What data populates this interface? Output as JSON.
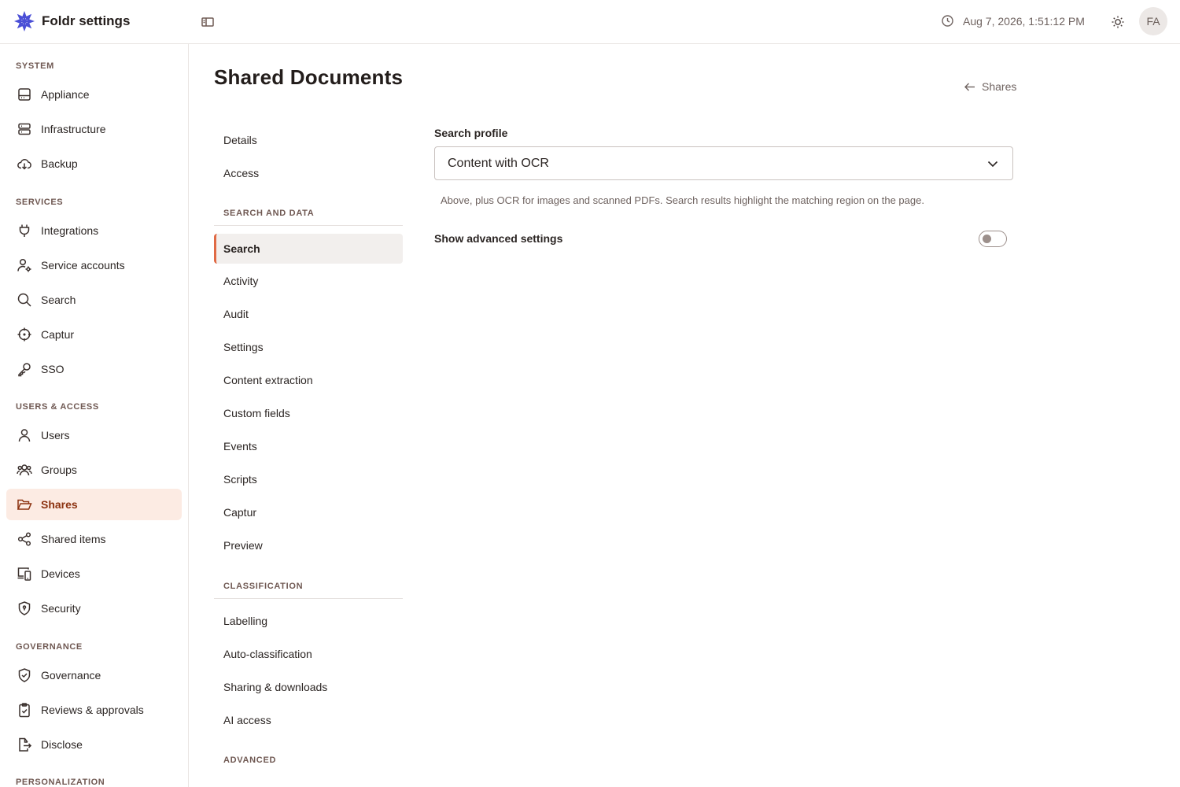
{
  "header": {
    "app_title": "Foldr settings",
    "datetime": "Aug 7, 2026, 1:51:12 PM",
    "avatar_initials": "FA",
    "brand_color": "#4a4fd6"
  },
  "sidebar": {
    "sections": [
      {
        "title": "SYSTEM",
        "items": [
          {
            "label": "Appliance",
            "icon": "appliance-icon"
          },
          {
            "label": "Infrastructure",
            "icon": "server-icon"
          },
          {
            "label": "Backup",
            "icon": "cloud-download-icon"
          }
        ]
      },
      {
        "title": "SERVICES",
        "items": [
          {
            "label": "Integrations",
            "icon": "plug-icon"
          },
          {
            "label": "Service accounts",
            "icon": "user-gear-icon"
          },
          {
            "label": "Search",
            "icon": "search-icon"
          },
          {
            "label": "Captur",
            "icon": "crosshair-icon"
          },
          {
            "label": "SSO",
            "icon": "key-icon"
          }
        ]
      },
      {
        "title": "USERS & ACCESS",
        "items": [
          {
            "label": "Users",
            "icon": "user-icon"
          },
          {
            "label": "Groups",
            "icon": "users-icon"
          },
          {
            "label": "Shares",
            "icon": "folder-open-icon",
            "active": true
          },
          {
            "label": "Shared items",
            "icon": "share-icon"
          },
          {
            "label": "Devices",
            "icon": "devices-icon"
          },
          {
            "label": "Security",
            "icon": "shield-icon"
          }
        ]
      },
      {
        "title": "GOVERNANCE",
        "items": [
          {
            "label": "Governance",
            "icon": "shield-check-icon"
          },
          {
            "label": "Reviews & approvals",
            "icon": "clipboard-check-icon"
          },
          {
            "label": "Disclose",
            "icon": "file-export-icon"
          }
        ]
      },
      {
        "title": "PERSONALIZATION",
        "items": []
      }
    ],
    "active_color": "#fcebe3"
  },
  "page": {
    "title": "Shared Documents",
    "back_label": "Shares"
  },
  "subnav": {
    "top_items": [
      "Details",
      "Access"
    ],
    "search_section_title": "SEARCH AND DATA",
    "search_items": [
      "Search",
      "Activity",
      "Audit",
      "Settings",
      "Content extraction",
      "Custom fields",
      "Events",
      "Scripts",
      "Captur",
      "Preview"
    ],
    "active_item": "Search",
    "classification_title": "CLASSIFICATION",
    "classification_items": [
      "Labelling",
      "Auto-classification",
      "Sharing & downloads",
      "AI access"
    ],
    "advanced_title": "ADVANCED",
    "accent_color": "#e06a45"
  },
  "search_settings": {
    "profile_label": "Search profile",
    "profile_value": "Content with OCR",
    "help_text": "Above, plus OCR for images and scanned PDFs. Search results highlight the matching region on the page.",
    "advanced_label": "Show advanced settings",
    "advanced_enabled": false
  }
}
